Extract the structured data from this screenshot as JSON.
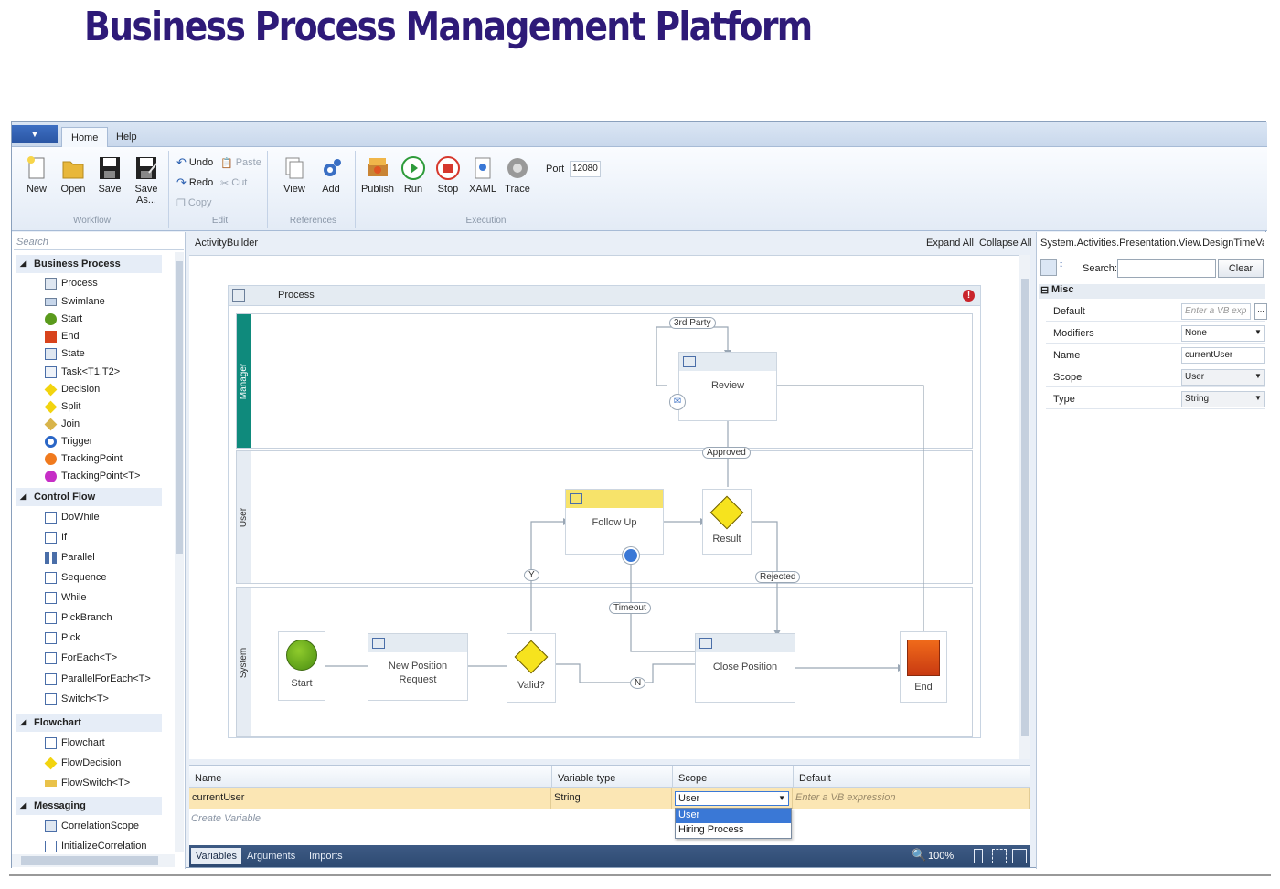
{
  "page_title": "Business Process Management Platform",
  "tabs": [
    {
      "label": "Home"
    },
    {
      "label": "Help"
    }
  ],
  "ribbon": {
    "workflow": {
      "label": "Workflow",
      "buttons": [
        {
          "label": "New"
        },
        {
          "label": "Open"
        },
        {
          "label": "Save"
        },
        {
          "label": "Save As..."
        }
      ]
    },
    "edit": {
      "label": "Edit",
      "undo": "Undo",
      "redo": "Redo",
      "copy": "Copy",
      "paste": "Paste",
      "cut": "Cut"
    },
    "references": {
      "label": "References",
      "buttons": [
        {
          "label": "View"
        },
        {
          "label": "Add"
        }
      ]
    },
    "execution": {
      "label": "Execution",
      "buttons": [
        {
          "label": "Publish"
        },
        {
          "label": "Run"
        },
        {
          "label": "Stop"
        },
        {
          "label": "XAML"
        },
        {
          "label": "Trace"
        }
      ],
      "port_label": "Port",
      "port_value": "12080"
    }
  },
  "toolbox": {
    "search_placeholder": "Search",
    "categories": [
      {
        "name": "Business Process",
        "items": [
          "Process",
          "Swimlane",
          "Start",
          "End",
          "State",
          "Task<T1,T2>",
          "Decision",
          "Split",
          "Join",
          "Trigger",
          "TrackingPoint",
          "TrackingPoint<T>"
        ]
      },
      {
        "name": "Control Flow",
        "items": [
          "DoWhile",
          "If",
          "Parallel",
          "Sequence",
          "While",
          "PickBranch",
          "Pick",
          "ForEach<T>",
          "ParallelForEach<T>",
          "Switch<T>"
        ]
      },
      {
        "name": "Flowchart",
        "items": [
          "Flowchart",
          "FlowDecision",
          "FlowSwitch<T>"
        ]
      },
      {
        "name": "Messaging",
        "items": [
          "CorrelationScope",
          "InitializeCorrelation"
        ]
      }
    ]
  },
  "canvas": {
    "breadcrumb": "ActivityBuilder",
    "expand_all": "Expand All",
    "collapse_all": "Collapse All",
    "process_title": "Process",
    "lanes": [
      {
        "name": "Manager"
      },
      {
        "name": "User"
      },
      {
        "name": "System"
      }
    ],
    "nodes": {
      "review": "Review",
      "follow_up": "Follow Up",
      "result": "Result",
      "start": "Start",
      "new_position": "New Position Request",
      "valid": "Valid?",
      "close_position": "Close Position",
      "end": "End"
    },
    "labels": {
      "third_party": "3rd Party",
      "approved": "Approved",
      "rejected": "Rejected",
      "timeout": "Timeout",
      "yes": "Y",
      "no": "N"
    }
  },
  "properties": {
    "title": "System.Activities.Presentation.View.DesignTimeVa...",
    "search_label": "Search:",
    "clear": "Clear",
    "category": "Misc",
    "rows": [
      {
        "key": "Default",
        "value": "Enter a VB exp"
      },
      {
        "key": "Modifiers",
        "value": "None"
      },
      {
        "key": "Name",
        "value": "currentUser"
      },
      {
        "key": "Scope",
        "value": "User"
      },
      {
        "key": "Type",
        "value": "String"
      }
    ]
  },
  "variables": {
    "headers": [
      "Name",
      "Variable type",
      "Scope",
      "Default"
    ],
    "row": {
      "name": "currentUser",
      "type": "String",
      "scope": "User",
      "default": "Enter a VB expression"
    },
    "create": "Create Variable",
    "scope_options": [
      "User",
      "Hiring Process"
    ]
  },
  "bottom": {
    "tabs": [
      "Variables",
      "Arguments",
      "Imports"
    ],
    "zoom": "100%"
  },
  "colors": {
    "title": "#2e1a78",
    "lane_bar": "#0f8a7c",
    "selected_row": "#fbe6b4",
    "highlight_blue": "#3a78d6"
  }
}
